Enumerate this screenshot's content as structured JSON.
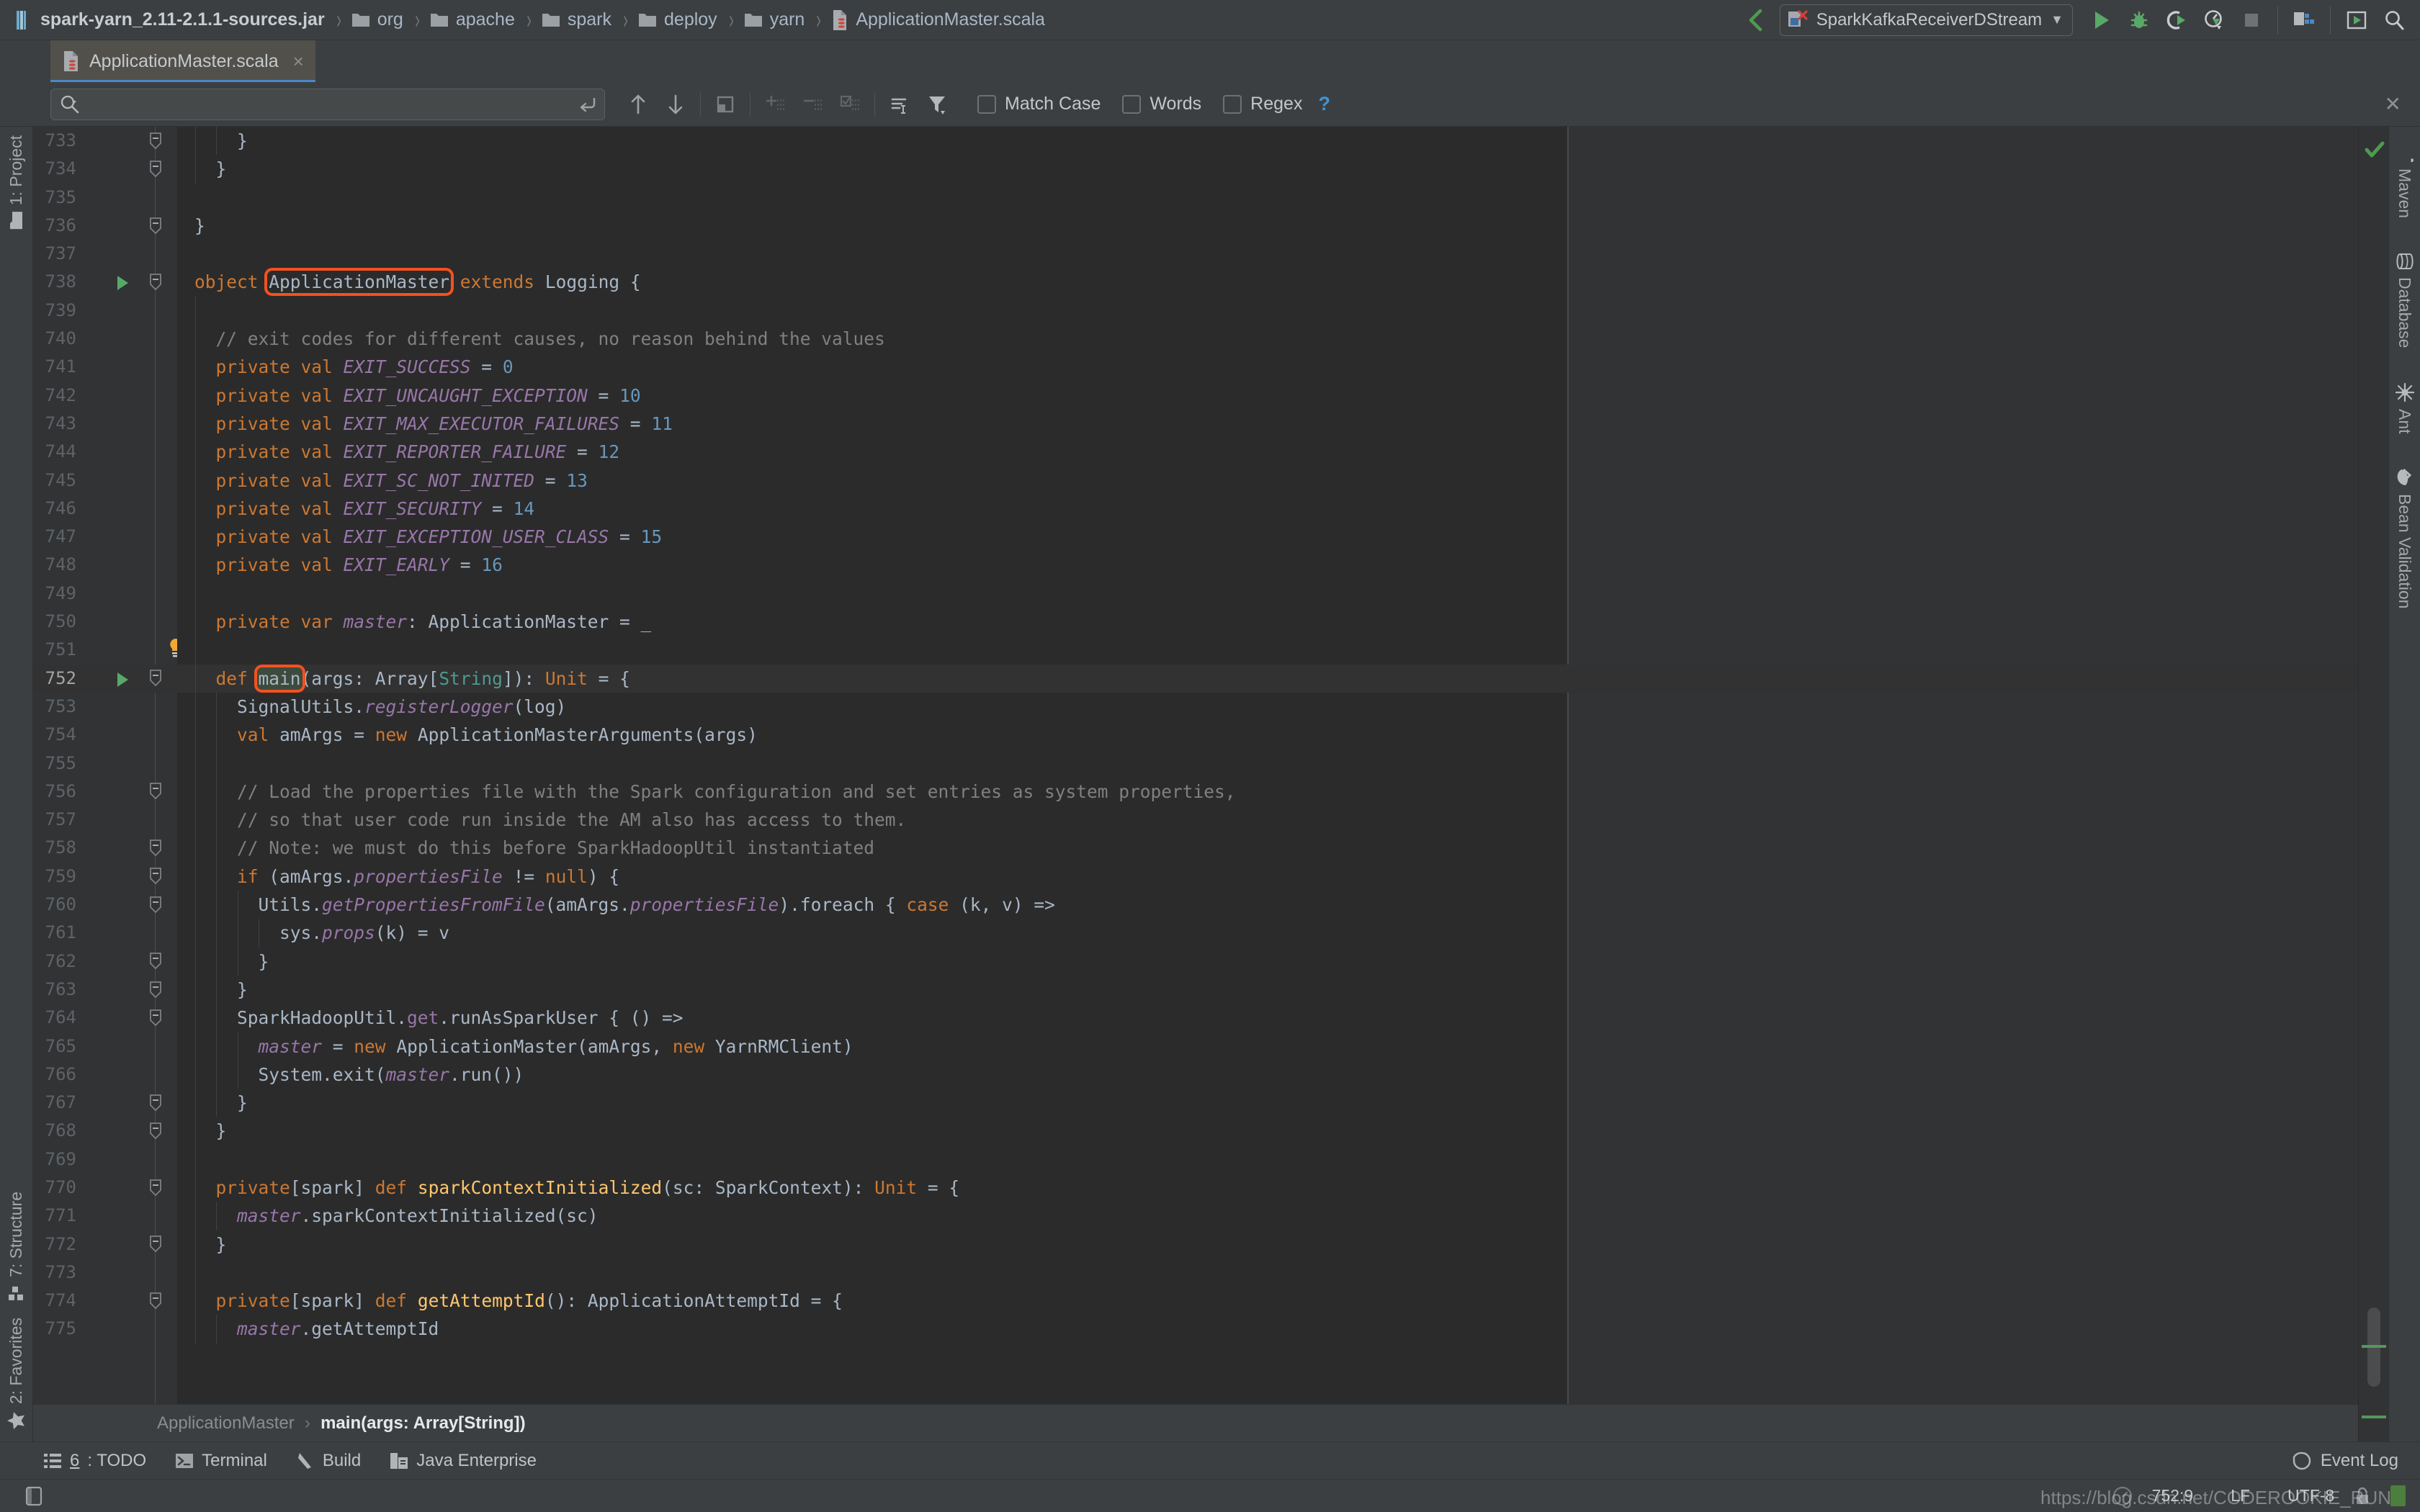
{
  "breadcrumb": {
    "items": [
      {
        "label": "spark-yarn_2.11-2.1.1-sources.jar",
        "icon": "jar-icon",
        "bold": true
      },
      {
        "label": "org",
        "icon": "folder-icon",
        "bold": false
      },
      {
        "label": "apache",
        "icon": "folder-icon",
        "bold": false
      },
      {
        "label": "spark",
        "icon": "folder-icon",
        "bold": false
      },
      {
        "label": "deploy",
        "icon": "folder-icon",
        "bold": false
      },
      {
        "label": "yarn",
        "icon": "folder-icon",
        "bold": false
      },
      {
        "label": "ApplicationMaster.scala",
        "icon": "scala-file-icon",
        "bold": false
      }
    ],
    "separator": "›"
  },
  "toolbar": {
    "back_icon": "back-arrow-icon",
    "run_config": {
      "label": "SparkKafkaReceiverDStream",
      "icon": "run-config-icon",
      "dropdown": "▼"
    },
    "buttons": [
      {
        "name": "run-button",
        "icon": "play-icon"
      },
      {
        "name": "debug-button",
        "icon": "bug-icon"
      },
      {
        "name": "run-coverage-button",
        "icon": "coverage-icon"
      },
      {
        "name": "profile-button",
        "icon": "profile-icon"
      },
      {
        "name": "stop-button",
        "icon": "stop-icon"
      },
      {
        "name": "project-structure-button",
        "icon": "project-structure-icon"
      },
      {
        "name": "updates-button",
        "icon": "update-icon"
      },
      {
        "name": "search-everywhere-button",
        "icon": "search-icon"
      }
    ]
  },
  "editor_tab": {
    "label": "ApplicationMaster.scala",
    "icon": "scala-file-icon",
    "close": "×"
  },
  "find": {
    "placeholder": "",
    "value": "",
    "search_icon": "search-icon",
    "multiline_icon": "multiline-toggle-icon",
    "prev_icon": "arrow-up-icon",
    "next_icon": "arrow-down-icon",
    "select_all_icon": "select-all-icon",
    "add_icon": "add-occurrence-icon",
    "remove_icon": "remove-occurrence-icon",
    "select_occurrences_icon": "select-all-occurrences-icon",
    "history_icon": "filter-list-icon",
    "filter_icon": "filter-icon",
    "close_icon": "close-icon",
    "options": [
      {
        "label": "Match Case",
        "checked": false,
        "name": "match-case-checkbox"
      },
      {
        "label": "Words",
        "checked": false,
        "name": "words-checkbox"
      },
      {
        "label": "Regex",
        "checked": false,
        "name": "regex-checkbox"
      }
    ],
    "help": "?"
  },
  "left_tool_tabs_top": [
    {
      "label": "1: Project",
      "icon": "project-folder-icon"
    }
  ],
  "left_tool_tabs_bottom": [
    {
      "label": "7: Structure",
      "icon": "structure-icon"
    },
    {
      "label": "2: Favorites",
      "icon": "star-icon"
    }
  ],
  "right_tool_tabs": [
    {
      "label": "Maven",
      "icon": "maven-icon"
    },
    {
      "label": "Database",
      "icon": "database-icon"
    },
    {
      "label": "Ant",
      "icon": "ant-icon"
    },
    {
      "label": "Bean Validation",
      "icon": "bean-validation-icon"
    }
  ],
  "structure_breadcrumb": {
    "parent": "ApplicationMaster",
    "separator": "›",
    "current": "main(args: Array[String])"
  },
  "bottom_tools": [
    {
      "label_num": "6",
      "label": ": TODO",
      "icon": "todo-icon",
      "name": "todo-tool-button"
    },
    {
      "label_num": "",
      "label": "Terminal",
      "icon": "terminal-icon",
      "name": "terminal-tool-button"
    },
    {
      "label_num": "",
      "label": "Build",
      "icon": "build-icon",
      "name": "build-tool-button"
    },
    {
      "label_num": "",
      "label": "Java Enterprise",
      "icon": "java-enterprise-icon",
      "name": "java-enterprise-tool-button"
    }
  ],
  "event_log": {
    "label": "Event Log",
    "icon": "event-log-icon"
  },
  "status": {
    "caret": "752:9",
    "line_sep": "LF",
    "encoding": "UTF-8",
    "lock_icon": "unlocked-icon",
    "inspection_icon": "inspection-icon",
    "watermark": "https://blog.csdn.net/CODEROOKIE_RUN"
  },
  "code": {
    "first_line": 733,
    "caret_line": 752,
    "highlight_words": [
      "ApplicationMaster",
      "main"
    ],
    "lines": [
      {
        "n": 733,
        "fold": "minus",
        "indent": 2,
        "tokens": [
          {
            "t": "    }",
            "c": "pln"
          }
        ]
      },
      {
        "n": 734,
        "fold": "minus",
        "indent": 1,
        "tokens": [
          {
            "t": "  }",
            "c": "pln"
          }
        ]
      },
      {
        "n": 735,
        "fold": "",
        "indent": 0,
        "tokens": []
      },
      {
        "n": 736,
        "fold": "minus",
        "indent": 0,
        "tokens": [
          {
            "t": "}",
            "c": "pln"
          }
        ]
      },
      {
        "n": 737,
        "fold": "",
        "indent": 0,
        "tokens": []
      },
      {
        "n": 738,
        "fold": "minus",
        "run": true,
        "indent": 0,
        "tokens": [
          {
            "t": "object ",
            "c": "kw"
          },
          {
            "t": "ApplicationMaster",
            "c": "pln",
            "box": true
          },
          {
            "t": " ",
            "c": "pln"
          },
          {
            "t": "extends ",
            "c": "kw"
          },
          {
            "t": "Logging {",
            "c": "pln"
          }
        ]
      },
      {
        "n": 739,
        "fold": "",
        "indent": 1,
        "tokens": []
      },
      {
        "n": 740,
        "fold": "",
        "indent": 1,
        "tokens": [
          {
            "t": "  // exit codes for different causes, no reason behind the values",
            "c": "cmt"
          }
        ]
      },
      {
        "n": 741,
        "fold": "",
        "indent": 1,
        "tokens": [
          {
            "t": "  ",
            "c": "pln"
          },
          {
            "t": "private val ",
            "c": "kw"
          },
          {
            "t": "EXIT_SUCCESS",
            "c": "fld"
          },
          {
            "t": " = ",
            "c": "pln"
          },
          {
            "t": "0",
            "c": "num"
          }
        ]
      },
      {
        "n": 742,
        "fold": "",
        "indent": 1,
        "tokens": [
          {
            "t": "  ",
            "c": "pln"
          },
          {
            "t": "private val ",
            "c": "kw"
          },
          {
            "t": "EXIT_UNCAUGHT_EXCEPTION",
            "c": "fld"
          },
          {
            "t": " = ",
            "c": "pln"
          },
          {
            "t": "10",
            "c": "num"
          }
        ]
      },
      {
        "n": 743,
        "fold": "",
        "indent": 1,
        "tokens": [
          {
            "t": "  ",
            "c": "pln"
          },
          {
            "t": "private val ",
            "c": "kw"
          },
          {
            "t": "EXIT_MAX_EXECUTOR_FAILURES",
            "c": "fld"
          },
          {
            "t": " = ",
            "c": "pln"
          },
          {
            "t": "11",
            "c": "num"
          }
        ]
      },
      {
        "n": 744,
        "fold": "",
        "indent": 1,
        "tokens": [
          {
            "t": "  ",
            "c": "pln"
          },
          {
            "t": "private val ",
            "c": "kw"
          },
          {
            "t": "EXIT_REPORTER_FAILURE",
            "c": "fld"
          },
          {
            "t": " = ",
            "c": "pln"
          },
          {
            "t": "12",
            "c": "num"
          }
        ]
      },
      {
        "n": 745,
        "fold": "",
        "indent": 1,
        "tokens": [
          {
            "t": "  ",
            "c": "pln"
          },
          {
            "t": "private val ",
            "c": "kw"
          },
          {
            "t": "EXIT_SC_NOT_INITED",
            "c": "fld"
          },
          {
            "t": " = ",
            "c": "pln"
          },
          {
            "t": "13",
            "c": "num"
          }
        ]
      },
      {
        "n": 746,
        "fold": "",
        "indent": 1,
        "tokens": [
          {
            "t": "  ",
            "c": "pln"
          },
          {
            "t": "private val ",
            "c": "kw"
          },
          {
            "t": "EXIT_SECURITY",
            "c": "fld"
          },
          {
            "t": " = ",
            "c": "pln"
          },
          {
            "t": "14",
            "c": "num"
          }
        ]
      },
      {
        "n": 747,
        "fold": "",
        "indent": 1,
        "tokens": [
          {
            "t": "  ",
            "c": "pln"
          },
          {
            "t": "private val ",
            "c": "kw"
          },
          {
            "t": "EXIT_EXCEPTION_USER_CLASS",
            "c": "fld"
          },
          {
            "t": " = ",
            "c": "pln"
          },
          {
            "t": "15",
            "c": "num"
          }
        ]
      },
      {
        "n": 748,
        "fold": "",
        "indent": 1,
        "tokens": [
          {
            "t": "  ",
            "c": "pln"
          },
          {
            "t": "private val ",
            "c": "kw"
          },
          {
            "t": "EXIT_EARLY",
            "c": "fld"
          },
          {
            "t": " = ",
            "c": "pln"
          },
          {
            "t": "16",
            "c": "num"
          }
        ]
      },
      {
        "n": 749,
        "fold": "",
        "indent": 1,
        "tokens": []
      },
      {
        "n": 750,
        "fold": "",
        "indent": 1,
        "tokens": [
          {
            "t": "  ",
            "c": "pln"
          },
          {
            "t": "private var ",
            "c": "kw"
          },
          {
            "t": "master",
            "c": "fld"
          },
          {
            "t": ": ApplicationMaster = _",
            "c": "pln"
          }
        ]
      },
      {
        "n": 751,
        "fold": "",
        "indent": 1,
        "bulb": true,
        "tokens": []
      },
      {
        "n": 752,
        "fold": "minus",
        "run": true,
        "caret": true,
        "indent": 1,
        "tokens": [
          {
            "t": "  ",
            "c": "pln"
          },
          {
            "t": "def ",
            "c": "kw"
          },
          {
            "t": "main",
            "c": "pln",
            "box": true,
            "ident": true
          },
          {
            "t": "(args: Array[",
            "c": "pln"
          },
          {
            "t": "String",
            "c": "grn"
          },
          {
            "t": "]): ",
            "c": "pln"
          },
          {
            "t": "Unit",
            "c": "kw"
          },
          {
            "t": " = {",
            "c": "pln"
          }
        ]
      },
      {
        "n": 753,
        "fold": "",
        "indent": 2,
        "tokens": [
          {
            "t": "    SignalUtils.",
            "c": "pln"
          },
          {
            "t": "registerLogger",
            "c": "fld"
          },
          {
            "t": "(log)",
            "c": "pln"
          }
        ]
      },
      {
        "n": 754,
        "fold": "",
        "indent": 2,
        "tokens": [
          {
            "t": "    ",
            "c": "pln"
          },
          {
            "t": "val ",
            "c": "kw"
          },
          {
            "t": "amArgs = ",
            "c": "pln"
          },
          {
            "t": "new ",
            "c": "kw"
          },
          {
            "t": "ApplicationMasterArguments(args)",
            "c": "pln"
          }
        ]
      },
      {
        "n": 755,
        "fold": "",
        "indent": 2,
        "tokens": []
      },
      {
        "n": 756,
        "fold": "minus",
        "indent": 2,
        "tokens": [
          {
            "t": "    // Load the properties file with the Spark configuration and set entries as system properties,",
            "c": "cmt"
          }
        ]
      },
      {
        "n": 757,
        "fold": "",
        "indent": 2,
        "tokens": [
          {
            "t": "    // so that user code run inside the AM also has access to them.",
            "c": "cmt"
          }
        ]
      },
      {
        "n": 758,
        "fold": "minus",
        "indent": 2,
        "tokens": [
          {
            "t": "    // Note: we must do this before SparkHadoopUtil instantiated",
            "c": "cmt"
          }
        ]
      },
      {
        "n": 759,
        "fold": "minus",
        "indent": 2,
        "tokens": [
          {
            "t": "    ",
            "c": "pln"
          },
          {
            "t": "if ",
            "c": "kw"
          },
          {
            "t": "(amArgs.",
            "c": "pln"
          },
          {
            "t": "propertiesFile",
            "c": "fld"
          },
          {
            "t": " != ",
            "c": "pln"
          },
          {
            "t": "null",
            "c": "kw"
          },
          {
            "t": ") {",
            "c": "pln"
          }
        ]
      },
      {
        "n": 760,
        "fold": "minus",
        "indent": 3,
        "tokens": [
          {
            "t": "      Utils.",
            "c": "pln"
          },
          {
            "t": "getPropertiesFromFile",
            "c": "fld"
          },
          {
            "t": "(amArgs.",
            "c": "pln"
          },
          {
            "t": "propertiesFile",
            "c": "fld"
          },
          {
            "t": ").foreach { ",
            "c": "pln"
          },
          {
            "t": "case ",
            "c": "kw"
          },
          {
            "t": "(k, v) =>",
            "c": "pln"
          }
        ]
      },
      {
        "n": 761,
        "fold": "",
        "indent": 4,
        "tokens": [
          {
            "t": "        sys.",
            "c": "pln"
          },
          {
            "t": "props",
            "c": "fld"
          },
          {
            "t": "(k) = v",
            "c": "pln"
          }
        ]
      },
      {
        "n": 762,
        "fold": "minus",
        "indent": 3,
        "tokens": [
          {
            "t": "      }",
            "c": "pln"
          }
        ]
      },
      {
        "n": 763,
        "fold": "minus",
        "indent": 2,
        "tokens": [
          {
            "t": "    }",
            "c": "pln"
          }
        ]
      },
      {
        "n": 764,
        "fold": "minus",
        "indent": 2,
        "tokens": [
          {
            "t": "    SparkHadoopUtil.",
            "c": "pln"
          },
          {
            "t": "get",
            "c": "fldn"
          },
          {
            "t": ".runAsSparkUser { () =>",
            "c": "pln"
          }
        ]
      },
      {
        "n": 765,
        "fold": "",
        "indent": 3,
        "tokens": [
          {
            "t": "      ",
            "c": "pln"
          },
          {
            "t": "master",
            "c": "fld"
          },
          {
            "t": " = ",
            "c": "pln"
          },
          {
            "t": "new ",
            "c": "kw"
          },
          {
            "t": "ApplicationMaster(amArgs, ",
            "c": "pln"
          },
          {
            "t": "new ",
            "c": "kw"
          },
          {
            "t": "YarnRMClient)",
            "c": "pln"
          }
        ]
      },
      {
        "n": 766,
        "fold": "",
        "indent": 3,
        "tokens": [
          {
            "t": "      System.exit(",
            "c": "pln"
          },
          {
            "t": "master",
            "c": "fld"
          },
          {
            "t": ".run())",
            "c": "pln"
          }
        ]
      },
      {
        "n": 767,
        "fold": "minus",
        "indent": 2,
        "tokens": [
          {
            "t": "    }",
            "c": "pln"
          }
        ]
      },
      {
        "n": 768,
        "fold": "minus",
        "indent": 1,
        "tokens": [
          {
            "t": "  }",
            "c": "pln"
          }
        ]
      },
      {
        "n": 769,
        "fold": "",
        "indent": 1,
        "tokens": []
      },
      {
        "n": 770,
        "fold": "minus",
        "indent": 1,
        "tokens": [
          {
            "t": "  ",
            "c": "pln"
          },
          {
            "t": "private",
            "c": "kw"
          },
          {
            "t": "[spark] ",
            "c": "pln"
          },
          {
            "t": "def ",
            "c": "kw"
          },
          {
            "t": "sparkContextInitialized",
            "c": "mth"
          },
          {
            "t": "(sc: SparkContext): ",
            "c": "pln"
          },
          {
            "t": "Unit",
            "c": "kw"
          },
          {
            "t": " = {",
            "c": "pln"
          }
        ]
      },
      {
        "n": 771,
        "fold": "",
        "indent": 2,
        "tokens": [
          {
            "t": "    ",
            "c": "pln"
          },
          {
            "t": "master",
            "c": "fld"
          },
          {
            "t": ".sparkContextInitialized(sc)",
            "c": "pln"
          }
        ]
      },
      {
        "n": 772,
        "fold": "minus",
        "indent": 1,
        "tokens": [
          {
            "t": "  }",
            "c": "pln"
          }
        ]
      },
      {
        "n": 773,
        "fold": "",
        "indent": 1,
        "tokens": []
      },
      {
        "n": 774,
        "fold": "minus",
        "indent": 1,
        "tokens": [
          {
            "t": "  ",
            "c": "pln"
          },
          {
            "t": "private",
            "c": "kw"
          },
          {
            "t": "[spark] ",
            "c": "pln"
          },
          {
            "t": "def ",
            "c": "kw"
          },
          {
            "t": "getAttemptId",
            "c": "mth"
          },
          {
            "t": "(): ApplicationAttemptId = {",
            "c": "pln"
          }
        ]
      },
      {
        "n": 775,
        "fold": "",
        "indent": 2,
        "tokens": [
          {
            "t": "    ",
            "c": "pln"
          },
          {
            "t": "master",
            "c": "fld"
          },
          {
            "t": ".getAttemptId",
            "c": "pln"
          }
        ]
      }
    ]
  }
}
